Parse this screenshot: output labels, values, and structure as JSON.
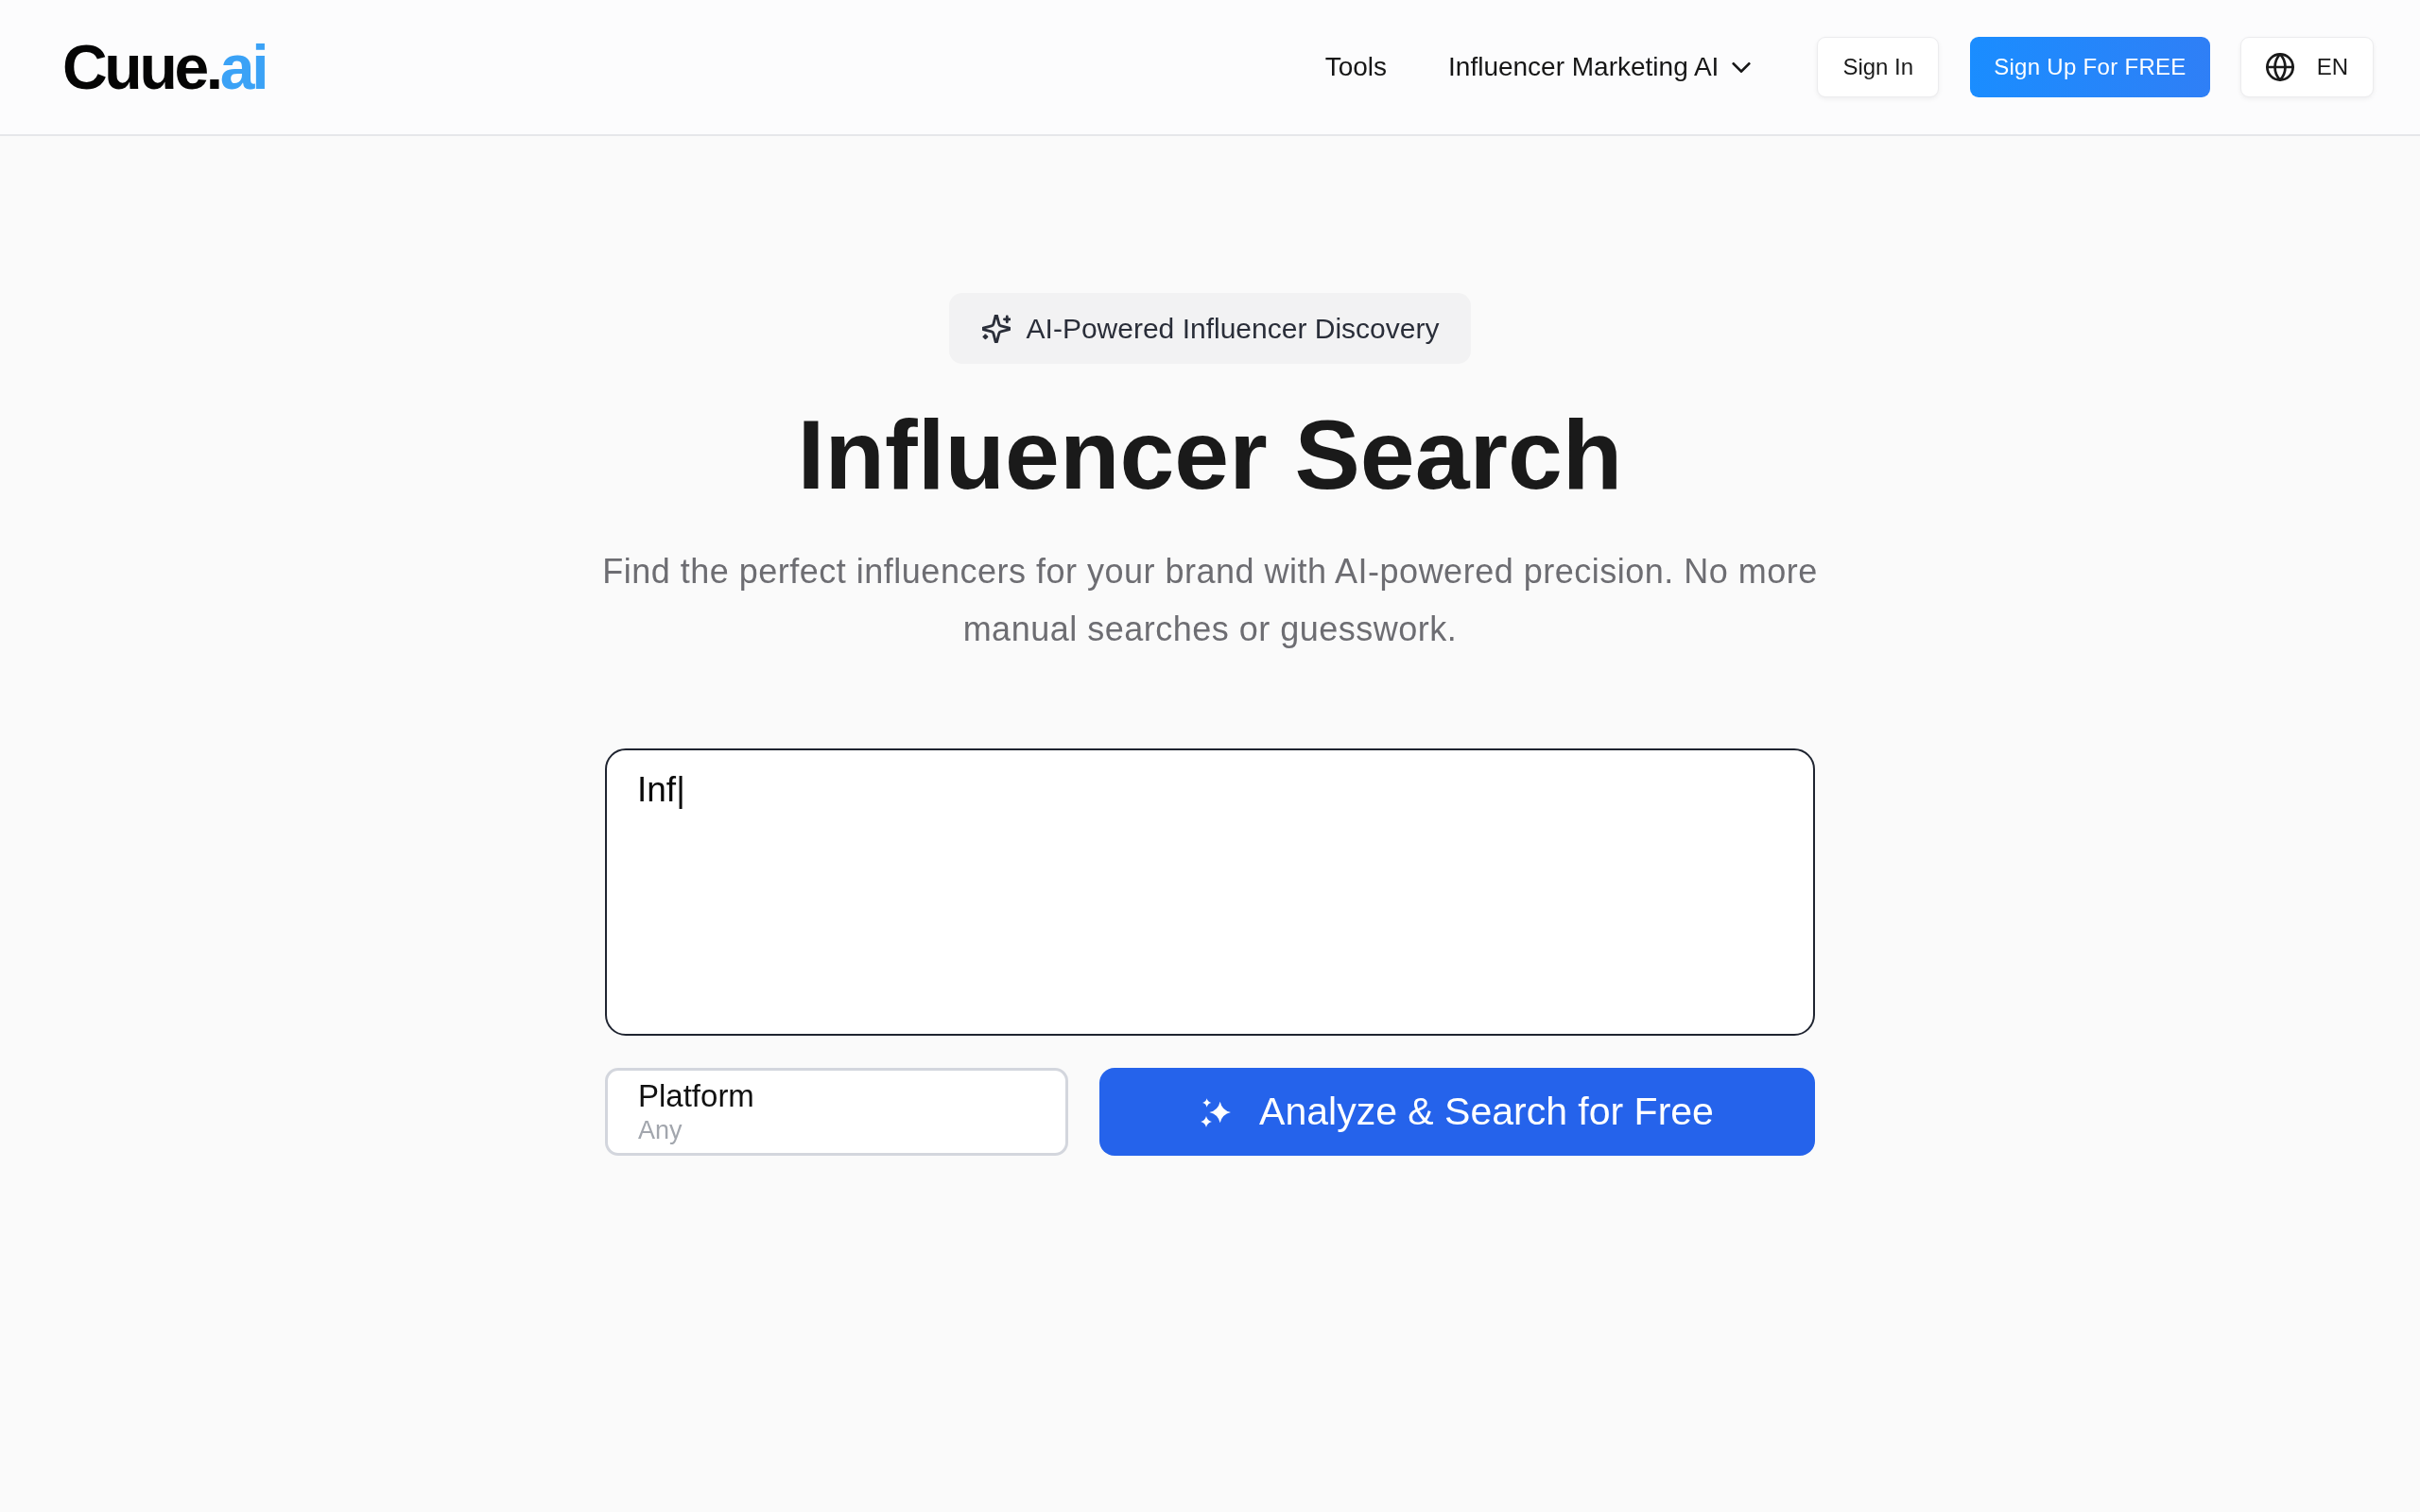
{
  "header": {
    "logo": {
      "text": "Cuue.",
      "accent": "ai"
    },
    "nav": [
      {
        "label": "Tools",
        "kind": "link"
      },
      {
        "label": "Influencer Marketing AI",
        "kind": "dropdown",
        "expanded": false
      }
    ],
    "sign_in": "Sign In",
    "sign_up": "Sign Up For FREE",
    "language": "EN"
  },
  "hero": {
    "badge": "AI-Powered Influencer Discovery",
    "title": "Influencer Search",
    "subtitle": "Find the perfect influencers for your brand with AI-powered precision. No more manual searches or guesswork.",
    "search": {
      "value": "Inf|"
    },
    "platform": {
      "label": "Platform",
      "value": "Any"
    },
    "submit": "Analyze & Search for Free"
  }
}
